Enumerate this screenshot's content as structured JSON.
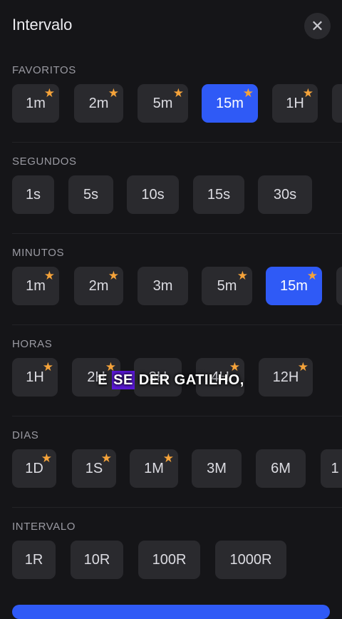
{
  "header": {
    "title": "Intervalo",
    "close_icon": "close-icon"
  },
  "sections": [
    {
      "label": "FAVORITOS",
      "chips": [
        {
          "label": "1m",
          "starred": true,
          "active": false
        },
        {
          "label": "2m",
          "starred": true,
          "active": false
        },
        {
          "label": "5m",
          "starred": true,
          "active": false
        },
        {
          "label": "15m",
          "starred": true,
          "active": true
        },
        {
          "label": "1H",
          "starred": true,
          "active": false
        },
        {
          "label": "",
          "starred": false,
          "active": false
        }
      ]
    },
    {
      "label": "SEGUNDOS",
      "chips": [
        {
          "label": "1s",
          "starred": false,
          "active": false
        },
        {
          "label": "5s",
          "starred": false,
          "active": false
        },
        {
          "label": "10s",
          "starred": false,
          "active": false
        },
        {
          "label": "15s",
          "starred": false,
          "active": false
        },
        {
          "label": "30s",
          "starred": false,
          "active": false
        }
      ]
    },
    {
      "label": "MINUTOS",
      "chips": [
        {
          "label": "1m",
          "starred": true,
          "active": false
        },
        {
          "label": "2m",
          "starred": true,
          "active": false
        },
        {
          "label": "3m",
          "starred": false,
          "active": false
        },
        {
          "label": "5m",
          "starred": true,
          "active": false
        },
        {
          "label": "15m",
          "starred": true,
          "active": true
        },
        {
          "label": "",
          "starred": false,
          "active": false
        }
      ]
    },
    {
      "label": "HORAS",
      "chips": [
        {
          "label": "1H",
          "starred": true,
          "active": false
        },
        {
          "label": "2H",
          "starred": true,
          "active": false
        },
        {
          "label": "3H",
          "starred": false,
          "active": false
        },
        {
          "label": "4H",
          "starred": true,
          "active": false
        },
        {
          "label": "12H",
          "starred": true,
          "active": false
        }
      ]
    },
    {
      "label": "DIAS",
      "chips": [
        {
          "label": "1D",
          "starred": true,
          "active": false
        },
        {
          "label": "1S",
          "starred": true,
          "active": false
        },
        {
          "label": "1M",
          "starred": true,
          "active": false
        },
        {
          "label": "3M",
          "starred": false,
          "active": false
        },
        {
          "label": "6M",
          "starred": false,
          "active": false
        },
        {
          "label": "1",
          "starred": false,
          "active": false
        }
      ]
    },
    {
      "label": "INTERVALO",
      "chips": [
        {
          "label": "1R",
          "starred": false,
          "active": false
        },
        {
          "label": "10R",
          "starred": false,
          "active": false
        },
        {
          "label": "100R",
          "starred": false,
          "active": false
        },
        {
          "label": "1000R",
          "starred": false,
          "active": false
        }
      ]
    }
  ],
  "caption": {
    "before": "E ",
    "highlight": "SE",
    "after": " DER GATILHO,"
  },
  "colors": {
    "accent": "#2f5af6",
    "star": "#f5a33a",
    "chip": "#2a2a2e",
    "background": "#151518"
  }
}
